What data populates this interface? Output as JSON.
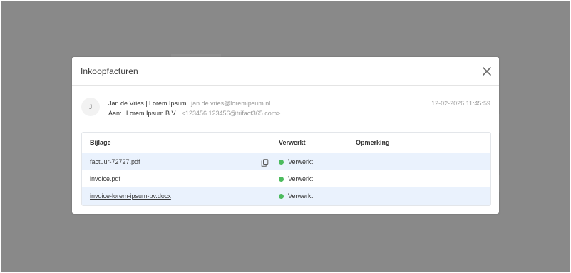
{
  "modal": {
    "title": "Inkoopfacturen",
    "close_icon": "close-icon"
  },
  "message": {
    "avatar_initial": "J",
    "sender_name": "Jan de Vries | Lorem Ipsum",
    "sender_email": "jan.de.vries@loremipsum.nl",
    "to_label": "Aan:",
    "to_name": "Lorem Ipsum B.V.",
    "to_email": "<123456.123456@trifact365.com>",
    "date": "12-02-2026 11:45:59"
  },
  "table": {
    "headers": {
      "attachment": "Bijlage",
      "processed": "Verwerkt",
      "remark": "Opmerking"
    },
    "rows": [
      {
        "file": "factuur-72727.pdf",
        "status": "Verwerkt",
        "remark": "",
        "has_copy_icon": true
      },
      {
        "file": "invoice.pdf",
        "status": "Verwerkt",
        "remark": "",
        "has_copy_icon": false
      },
      {
        "file": "invoice-lorem-ipsum-bv.docx",
        "status": "Verwerkt",
        "remark": "",
        "has_copy_icon": false
      }
    ]
  },
  "colors": {
    "backdrop": "#898989",
    "status_ok": "#4cbb5e",
    "row_highlight": "#eaf2fd"
  }
}
